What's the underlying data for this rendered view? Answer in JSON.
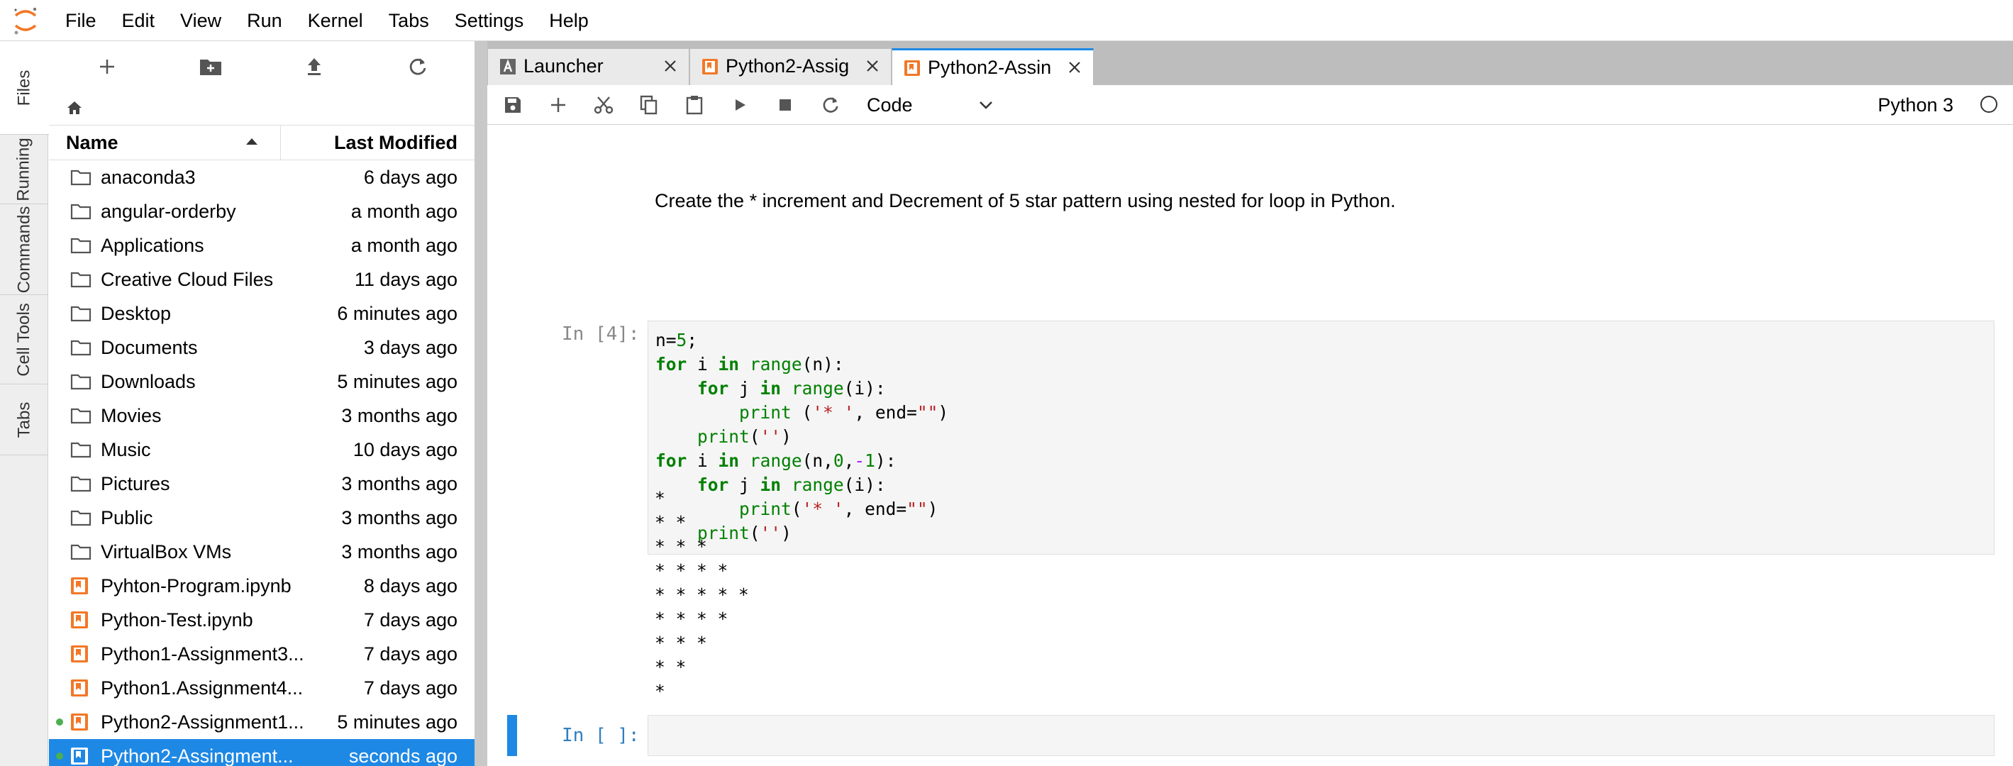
{
  "menubar": {
    "items": [
      "File",
      "Edit",
      "View",
      "Run",
      "Kernel",
      "Tabs",
      "Settings",
      "Help"
    ]
  },
  "left_tabs": [
    "Files",
    "Running",
    "Commands",
    "Cell Tools",
    "Tabs"
  ],
  "file_browser": {
    "columns": {
      "name": "Name",
      "modified": "Last Modified"
    },
    "items": [
      {
        "name": "anaconda3",
        "modified": "6 days ago",
        "type": "folder"
      },
      {
        "name": "angular-orderby",
        "modified": "a month ago",
        "type": "folder"
      },
      {
        "name": "Applications",
        "modified": "a month ago",
        "type": "folder"
      },
      {
        "name": "Creative Cloud Files",
        "modified": "11 days ago",
        "type": "folder"
      },
      {
        "name": "Desktop",
        "modified": "6 minutes ago",
        "type": "folder"
      },
      {
        "name": "Documents",
        "modified": "3 days ago",
        "type": "folder"
      },
      {
        "name": "Downloads",
        "modified": "5 minutes ago",
        "type": "folder"
      },
      {
        "name": "Movies",
        "modified": "3 months ago",
        "type": "folder"
      },
      {
        "name": "Music",
        "modified": "10 days ago",
        "type": "folder"
      },
      {
        "name": "Pictures",
        "modified": "3 months ago",
        "type": "folder"
      },
      {
        "name": "Public",
        "modified": "3 months ago",
        "type": "folder"
      },
      {
        "name": "VirtualBox VMs",
        "modified": "3 months ago",
        "type": "folder"
      },
      {
        "name": "Pyhton-Program.ipynb",
        "modified": "8 days ago",
        "type": "notebook"
      },
      {
        "name": "Python-Test.ipynb",
        "modified": "7 days ago",
        "type": "notebook"
      },
      {
        "name": "Python1-Assignment3...",
        "modified": "7 days ago",
        "type": "notebook"
      },
      {
        "name": "Python1.Assignment4...",
        "modified": "7 days ago",
        "type": "notebook"
      },
      {
        "name": "Python2-Assignment1...",
        "modified": "5 minutes ago",
        "type": "notebook",
        "running": true
      },
      {
        "name": "Python2-Assingment...",
        "modified": "seconds ago",
        "type": "notebook",
        "running": true,
        "selected": true
      }
    ]
  },
  "doc_tabs": [
    {
      "label": "Launcher",
      "icon": "launcher-icon",
      "active": false
    },
    {
      "label": "Python2-Assig",
      "icon": "notebook-icon",
      "active": false
    },
    {
      "label": "Python2-Assin",
      "icon": "notebook-icon",
      "active": true
    }
  ],
  "notebook_toolbar": {
    "cell_type": "Code",
    "kernel": "Python 3"
  },
  "notebook": {
    "markdown": "Create the * increment and Decrement of 5 star pattern using nested for loop in Python.",
    "cell1_prompt": "In [4]:",
    "cell2_prompt": "In [ ]:",
    "output_lines": [
      "*",
      "* *",
      "* * *",
      "* * * *",
      "* * * * *",
      "* * * *",
      "* * *",
      "* *",
      "*"
    ]
  },
  "colors": {
    "accent": "#1e88e5",
    "notebook_icon": "#f37726",
    "logo": "#f37726",
    "running": "#4caf50"
  }
}
